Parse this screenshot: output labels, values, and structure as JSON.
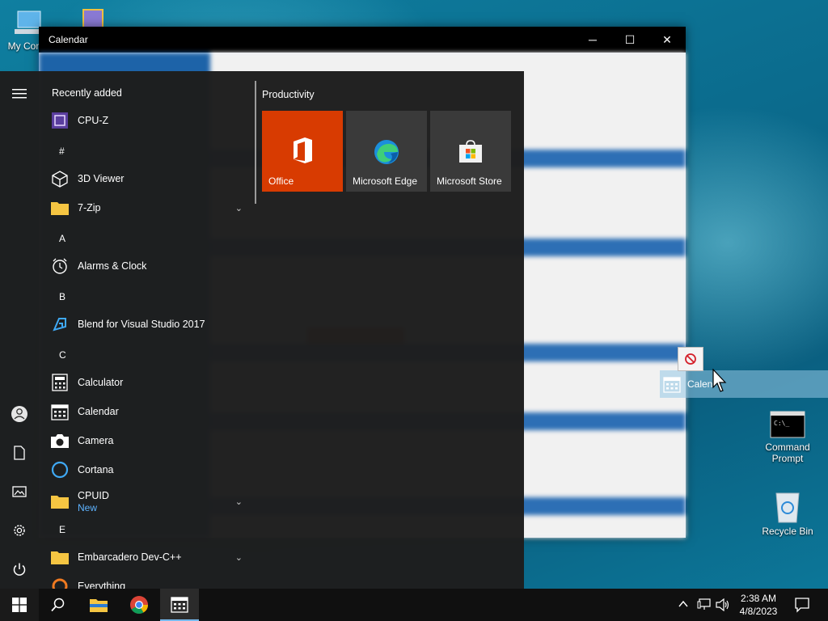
{
  "desktop": {
    "icons": [
      {
        "label": "My Com",
        "icon": "computer-icon"
      },
      {
        "label": "",
        "icon": "cpuid-shortcut-icon"
      },
      {
        "label": "Command Prompt",
        "icon": "command-prompt-icon"
      },
      {
        "label": "Recycle Bin",
        "icon": "recycle-bin-icon"
      }
    ]
  },
  "calendar_window": {
    "title": "Calendar",
    "minimize": "─",
    "maximize": "☐",
    "close": "✕"
  },
  "start_menu": {
    "rail": [
      "menu-icon",
      "user-icon",
      "documents-icon",
      "pictures-icon",
      "settings-icon",
      "power-icon"
    ],
    "recently_added_header": "Recently added",
    "apps": [
      {
        "label": "CPU-Z",
        "icon": "cpuz-icon"
      },
      {
        "label": "3D Viewer",
        "icon": "3d-viewer-icon"
      },
      {
        "label": "7-Zip",
        "icon": "folder-icon",
        "expand": "⌄"
      },
      {
        "label": "Alarms & Clock",
        "icon": "alarm-clock-icon"
      },
      {
        "label": "Blend for Visual Studio 2017",
        "icon": "blend-icon"
      },
      {
        "label": "Calculator",
        "icon": "calculator-icon"
      },
      {
        "label": "Calendar",
        "icon": "calendar-icon"
      },
      {
        "label": "Camera",
        "icon": "camera-icon"
      },
      {
        "label": "Cortana",
        "icon": "cortana-icon"
      },
      {
        "label": "CPUID",
        "sub": "New",
        "icon": "folder-icon",
        "expand": "⌄"
      },
      {
        "label": "Embarcadero Dev-C++",
        "icon": "folder-icon",
        "expand": "⌄"
      },
      {
        "label": "Everything",
        "icon": "everything-icon"
      }
    ],
    "letters": [
      "#",
      "A",
      "B",
      "C",
      "E"
    ],
    "tiles_group": "Productivity",
    "tiles": [
      {
        "label": "Office",
        "color": "#d83b01",
        "icon": "office-icon"
      },
      {
        "label": "Microsoft Edge",
        "color": "#3a3a3a",
        "icon": "edge-icon"
      },
      {
        "label": "Microsoft Store",
        "color": "#3a3a3a",
        "icon": "store-icon"
      }
    ]
  },
  "drag": {
    "label": "Calen"
  },
  "taskbar": {
    "time": "2:38 AM",
    "date": "4/8/2023",
    "pinned": [
      "search-icon",
      "file-explorer-icon",
      "chrome-icon",
      "calendar-icon"
    ]
  }
}
